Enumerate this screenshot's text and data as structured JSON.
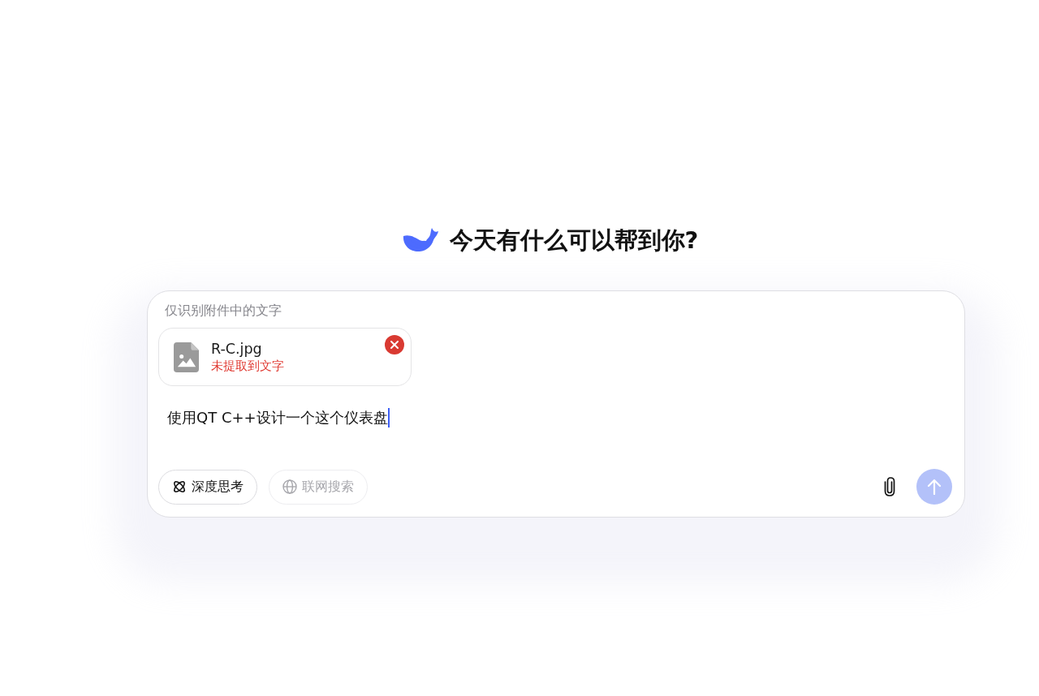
{
  "greeting": "今天有什么可以帮到你?",
  "composer": {
    "notice": "仅识别附件中的文字",
    "attachments": [
      {
        "kind": "image",
        "name": "R-C.jpg",
        "status": "未提取到文字",
        "failed": true
      }
    ],
    "input": {
      "value": "使用QT C++设计一个这个仪表盘"
    },
    "toggles": [
      {
        "kind": "reasoning",
        "label": "深度思考",
        "disabled": false
      },
      {
        "kind": "search",
        "label": "联网搜索",
        "disabled": true
      }
    ],
    "send_button": {
      "disabled": true
    }
  }
}
